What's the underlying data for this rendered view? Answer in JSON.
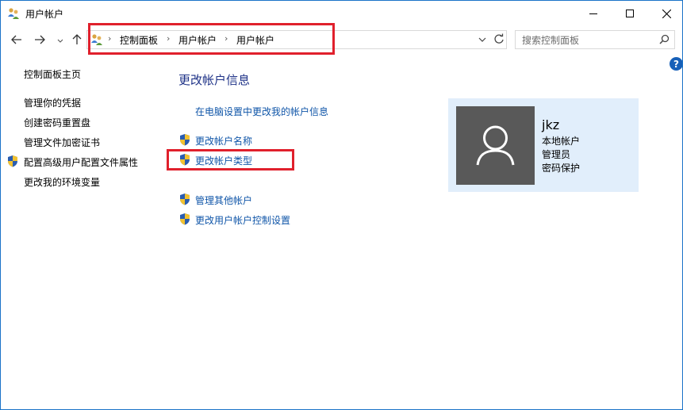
{
  "window": {
    "title": "用户帐户"
  },
  "navbar": {
    "breadcrumbs": [
      "控制面板",
      "用户帐户",
      "用户帐户"
    ],
    "search_placeholder": "搜索控制面板"
  },
  "sidebar": {
    "items": [
      {
        "label": "控制面板主页",
        "shield": false
      },
      {
        "label": "管理你的凭据",
        "shield": false
      },
      {
        "label": "创建密码重置盘",
        "shield": false
      },
      {
        "label": "管理文件加密证书",
        "shield": false
      },
      {
        "label": "配置高级用户配置文件属性",
        "shield": true
      },
      {
        "label": "更改我的环境变量",
        "shield": false
      }
    ]
  },
  "main": {
    "heading": "更改帐户信息",
    "link_pc_settings": "在电脑设置中更改我的帐户信息",
    "tasks": [
      {
        "label": "更改帐户名称",
        "icon": "uac-shield-icon"
      },
      {
        "label": "更改帐户类型",
        "icon": "uac-shield-icon"
      },
      {
        "label": "管理其他帐户",
        "icon": "uac-shield-icon"
      },
      {
        "label": "更改用户帐户控制设置",
        "icon": "uac-shield-icon"
      }
    ]
  },
  "account": {
    "name": "jkz",
    "type": "本地帐户",
    "role": "管理员",
    "password": "密码保护"
  },
  "help": {
    "label": "?"
  },
  "colors": {
    "link": "#0f55a8",
    "heading": "#1e3287",
    "card_bg": "#e1eefb",
    "highlight": "#e0202c"
  }
}
